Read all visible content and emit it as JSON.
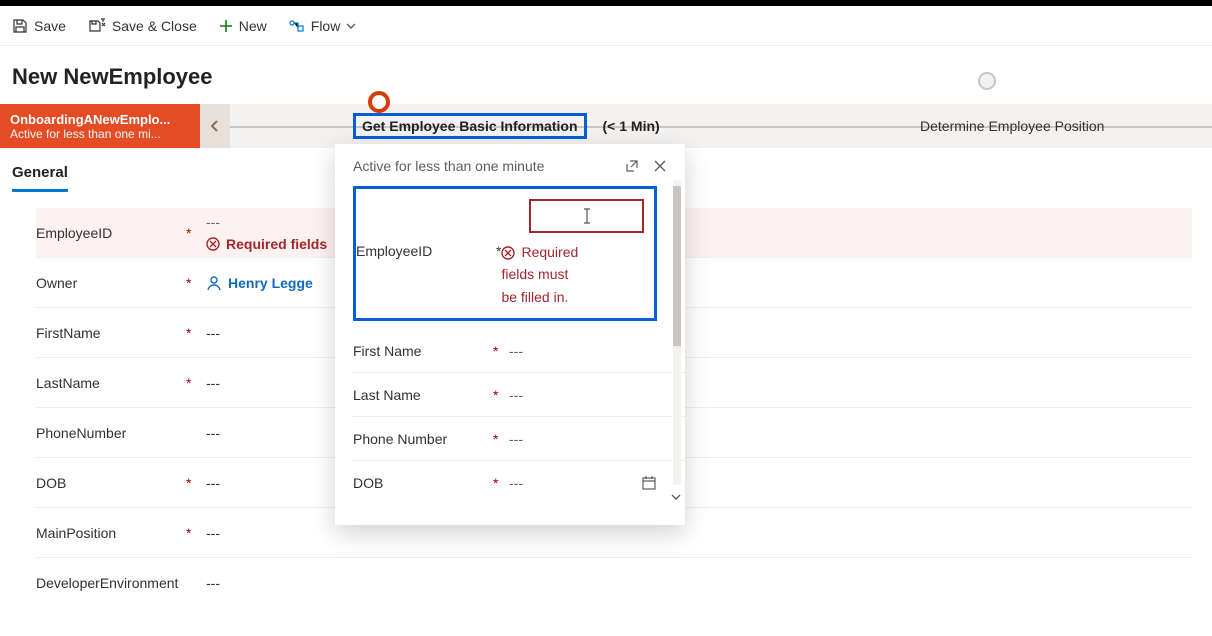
{
  "toolbar": {
    "save": "Save",
    "save_close": "Save & Close",
    "new": "New",
    "flow": "Flow"
  },
  "page": {
    "title": "New NewEmployee"
  },
  "bpf": {
    "name": "OnboardingANewEmplo...",
    "subtitle": "Active for less than one mi...",
    "stage1_label": "Get Employee Basic Information",
    "stage1_time": "(< 1 Min)",
    "stage2_label": "Determine Employee Position"
  },
  "tabs": {
    "general": "General"
  },
  "form": {
    "employee_id_label": "EmployeeID",
    "employee_id_value": "---",
    "employee_id_error": "Required fields",
    "owner_label": "Owner",
    "owner_value": "Henry Legge",
    "firstname_label": "FirstName",
    "firstname_value": "---",
    "lastname_label": "LastName",
    "lastname_value": "---",
    "phone_label": "PhoneNumber",
    "phone_value": "---",
    "dob_label": "DOB",
    "dob_value": "---",
    "mainpos_label": "MainPosition",
    "mainpos_value": "---",
    "devenv_label": "DeveloperEnvironment",
    "devenv_value": "---"
  },
  "flyout": {
    "status": "Active for less than one minute",
    "employee_id_label": "EmployeeID",
    "error_line1": "Required",
    "error_line2": "fields must",
    "error_line3": "be filled in.",
    "firstname_label": "First Name",
    "firstname_value": "---",
    "lastname_label": "Last Name",
    "lastname_value": "---",
    "phone_label": "Phone Number",
    "phone_value": "---",
    "dob_label": "DOB",
    "dob_value": "---"
  }
}
